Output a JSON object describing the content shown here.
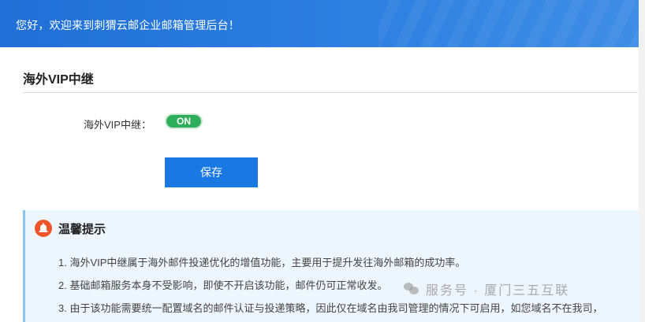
{
  "header": {
    "welcome_text": "您好，欢迎来到刺猬云邮企业邮箱管理后台！"
  },
  "page": {
    "title": "海外VIP中继"
  },
  "form": {
    "field_label": "海外VIP中继：",
    "toggle_state": "ON",
    "save_label": "保存"
  },
  "tips": {
    "title": "温馨提示",
    "icon": "bell-icon",
    "items": [
      "1. 海外VIP中继属于海外邮件投递优化的增值功能，主要用于提升发往海外邮箱的成功率。",
      "2. 基础邮箱服务本身不受影响，即使不开启该功能，邮件仍可正常收发。",
      "3. 由于该功能需要统一配置域名的邮件认证与投递策略，因此仅在域名由我司管理的情况下可启用，如您域名不在我司，"
    ]
  },
  "watermark": {
    "text": "服务号 · 厦门三五互联"
  },
  "colors": {
    "banner": "#1f6fd6",
    "toggle_on": "#2fae5a",
    "primary_button": "#1a78e3",
    "tips_background": "#edf6fd",
    "tips_icon": "#f0552a"
  }
}
